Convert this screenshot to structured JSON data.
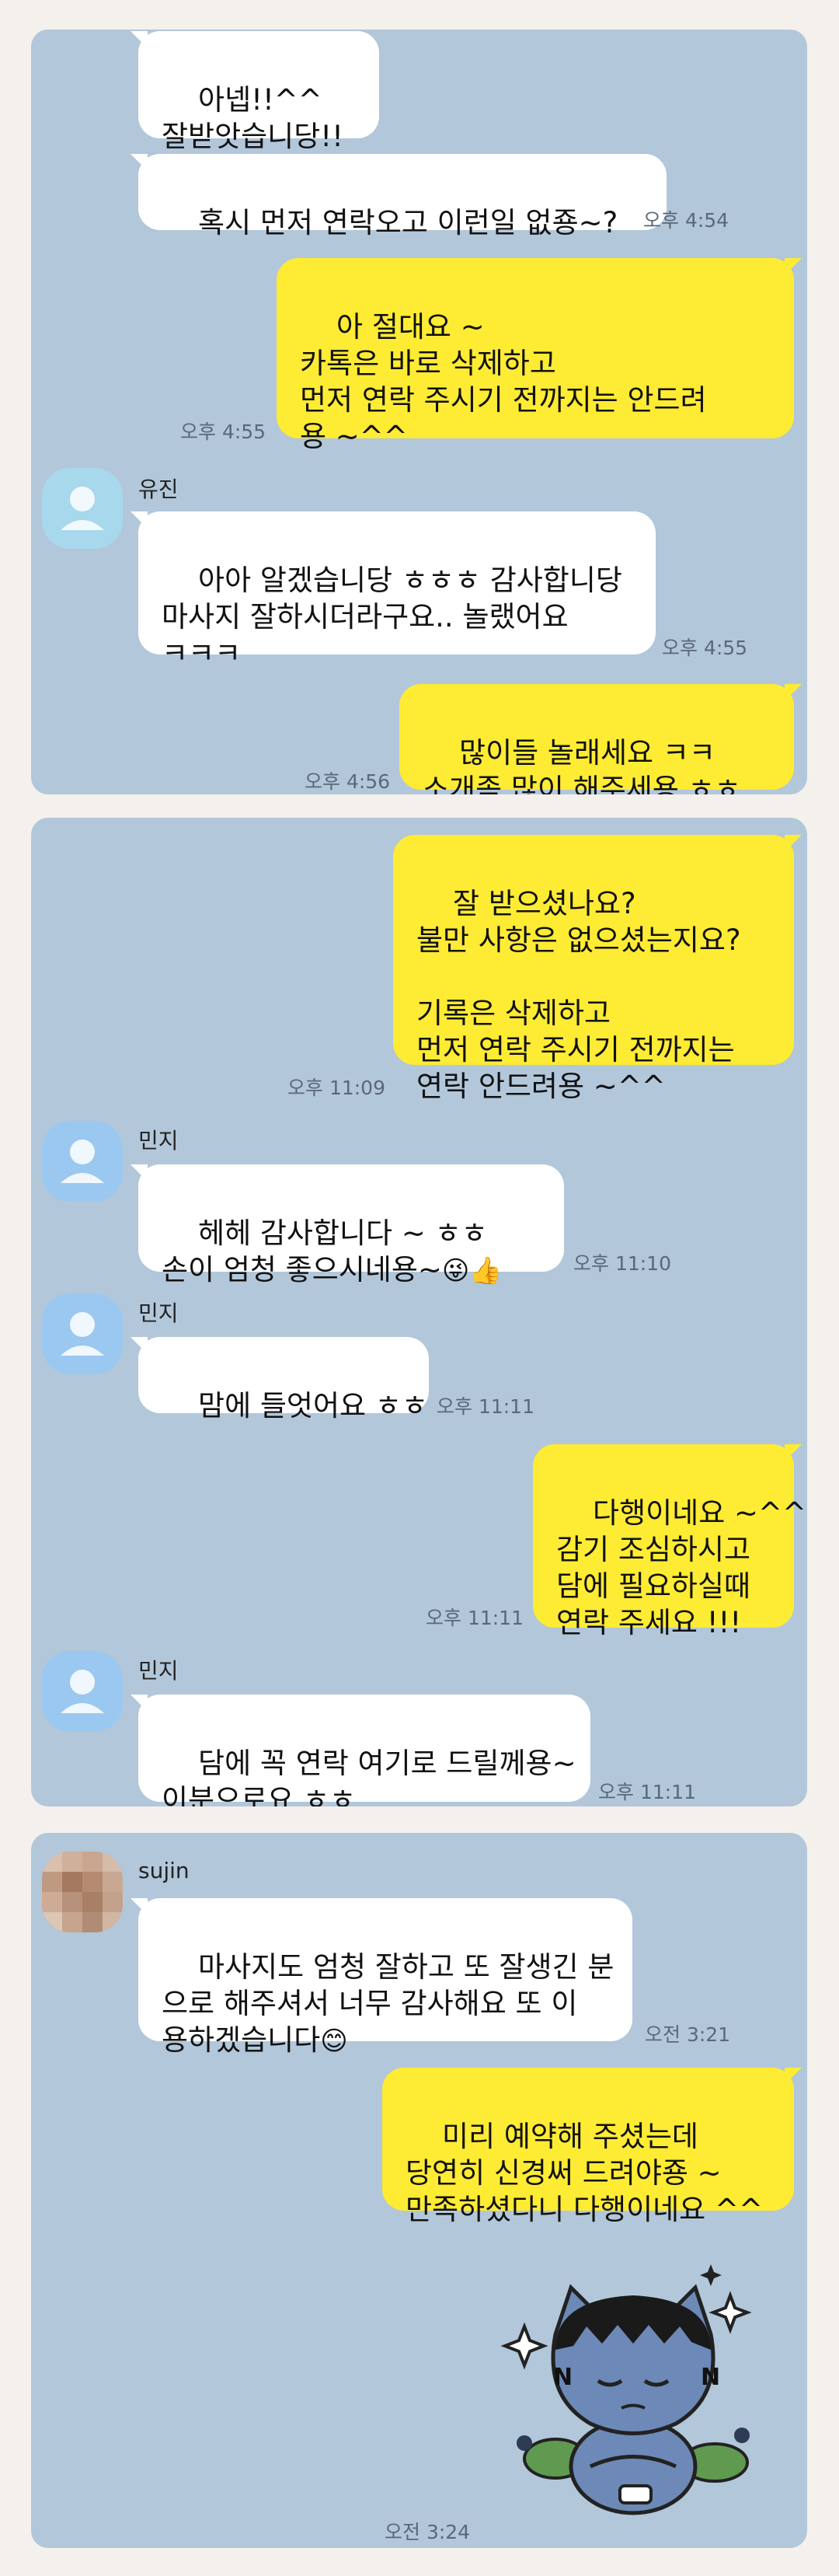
{
  "colors": {
    "panel_bg": "#b2c7da",
    "bubble_in": "#ffffff",
    "bubble_out": "#feeb34",
    "page_bg": "#f4f0ec"
  },
  "panels": [
    {
      "messages": [
        {
          "text": "아넵!!^^\n잘받앗습니당!!"
        },
        {
          "text": "혹시 먼저 연락오고 이런일 없죵~?",
          "time": "오후 4:54"
        },
        {
          "text": "아 절대요 ~\n카톡은 바로 삭제하고\n먼저 연락 주시기 전까지는 안드려\n용 ~^^",
          "time": "오후 4:55"
        },
        {
          "sender": "유진",
          "text": "아아 알겠습니당 ㅎㅎㅎ 감사합니당\n마사지 잘하시더라구요.. 놀랬어요\nㅋㅋㅋ",
          "time": "오후 4:55"
        },
        {
          "text": "많이들 놀래세요 ㅋㅋ\n소개좀 많이 해주세용 ㅎㅎ",
          "time": "오후 4:56"
        }
      ]
    },
    {
      "messages": [
        {
          "text": "잘 받으셨나요?\n불만 사항은 없으셨는지요?\n\n기록은 삭제하고\n먼저 연락 주시기 전까지는\n연락 안드려용 ~^^",
          "time": "오후 11:09"
        },
        {
          "sender": "민지",
          "text": "헤헤 감사합니다 ~ ㅎㅎ\n손이 엄청 좋으시네용~",
          "emoji": "😜👍",
          "time": "오후 11:10"
        },
        {
          "sender": "민지",
          "text": "맘에 들엇어요 ㅎㅎ",
          "time": "오후 11:11"
        },
        {
          "text": "다행이네요 ~^^\n감기 조심하시고\n담에 필요하실때\n연락 주세요 !!!",
          "time": "오후 11:11"
        },
        {
          "sender": "민지",
          "text": "담에 꼭 연락 여기로 드릴께용~\n이분으로요 ㅎㅎ",
          "time": "오후 11:11"
        }
      ]
    },
    {
      "messages": [
        {
          "sender": "sujin",
          "text": "마사지도 엄청 잘하고 또 잘생긴 분\n으로 해주셔서 너무 감사해요 또 이\n용하겠습니다",
          "emoji": "😊",
          "time": "오전 3:21"
        },
        {
          "text": "미리 예약해 주셨는데\n당연히 신경써 드려야죵 ~\n만족하셨다니 다행이네요 ^^"
        },
        {
          "sticker": "kakao-character-sticker",
          "time": "오전 3:24"
        }
      ]
    }
  ]
}
